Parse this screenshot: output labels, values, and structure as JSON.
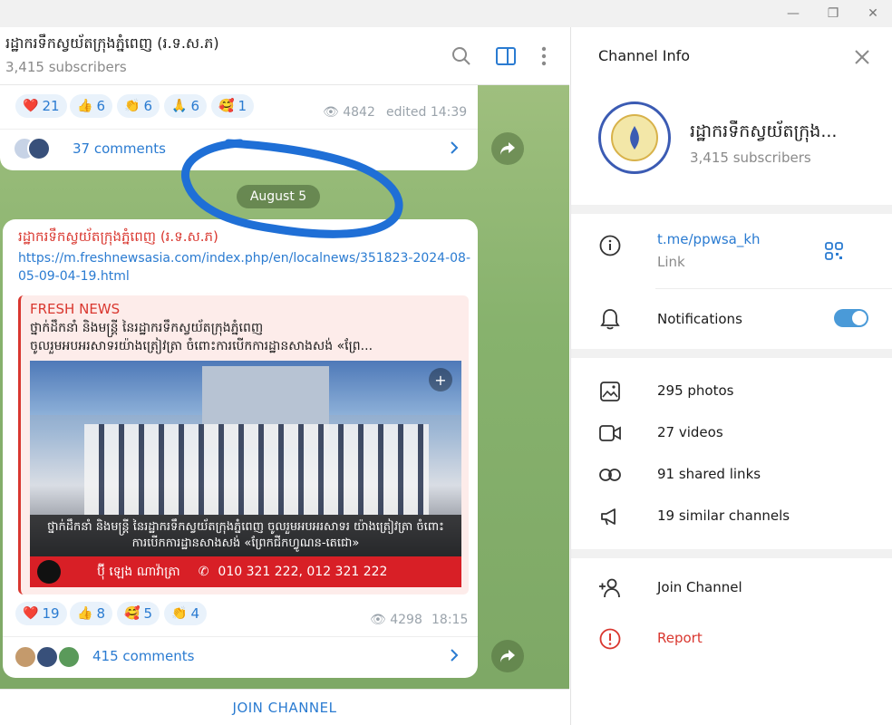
{
  "window": {
    "minimize": "—",
    "restore": "❐",
    "close": "✕"
  },
  "chat": {
    "title": "រដ្ឋាករទឹកស្វយ័តក្រុងភ្នំពេញ (រ.ទ.ស.ភ)",
    "subtitle": "3,415 subscribers"
  },
  "post1": {
    "reactions": [
      {
        "emoji": "❤️",
        "count": "21"
      },
      {
        "emoji": "👍",
        "count": "6"
      },
      {
        "emoji": "👏",
        "count": "6"
      },
      {
        "emoji": "🙏",
        "count": "6"
      },
      {
        "emoji": "🥰",
        "count": "1"
      }
    ],
    "views": "4842",
    "time": "edited 14:39",
    "comments": "37 comments"
  },
  "date_separator": "August 5",
  "post2": {
    "sender": "រដ្ឋាករទឹកស្វយ័តក្រុងភ្នំពេញ (រ.ទ.ស.ភ)",
    "link": "https://m.freshnewsasia.com/index.php/en/localnews/351823-2024-08-05-09-04-19.html",
    "preview_site": "FRESH NEWS",
    "preview_title_line1": "ថ្នាក់ដឹកនាំ និងមន្ត្រី នៃរដ្ឋាករទឹកស្វយ័តក្រុងភ្នំពេញ",
    "preview_title_line2": "ចូលរួមអបអរសាទរយ៉ាងត្រៀវត្រា ចំពោះការបើកការដ្ឋានសាងសង់ «ព្រែ...",
    "image_caption": "ថ្នាក់ដឹកនាំ និងមន្ត្រី នៃរដ្ឋាករទឹកស្វយ័តក្រុងភ្នំពេញ ចូលរួមអបអរសាទរ យ៉ាងត្រៀវត្រា ចំពោះការបើកការដ្ឋានសាងសង់ «ព្រែកជីកហ្វូណន-តេជោ»",
    "banner_name": "ប៊ុី ឡេង ណាវ៉ាត្រា",
    "banner_phone": "010 321 222, 012 321 222",
    "reactions": [
      {
        "emoji": "❤️",
        "count": "19"
      },
      {
        "emoji": "👍",
        "count": "8"
      },
      {
        "emoji": "🥰",
        "count": "5"
      },
      {
        "emoji": "👏",
        "count": "4"
      }
    ],
    "views": "4298",
    "time": "18:15",
    "comments": "415 comments"
  },
  "join_button": "JOIN CHANNEL",
  "info": {
    "header": "Channel Info",
    "name": "រដ្ឋាករទឹកស្វយ័តក្រុង...",
    "subs": "3,415 subscribers",
    "link_value": "t.me/ppwsa_kh",
    "link_label": "Link",
    "notifications": "Notifications",
    "notifications_on": true,
    "photos": "295 photos",
    "videos": "27 videos",
    "shared_links": "91 shared links",
    "similar": "19 similar channels",
    "join": "Join Channel",
    "report": "Report"
  },
  "colors": {
    "accent": "#2a7bd1",
    "danger": "#d9372f",
    "annotation": "#1f6fd6"
  }
}
